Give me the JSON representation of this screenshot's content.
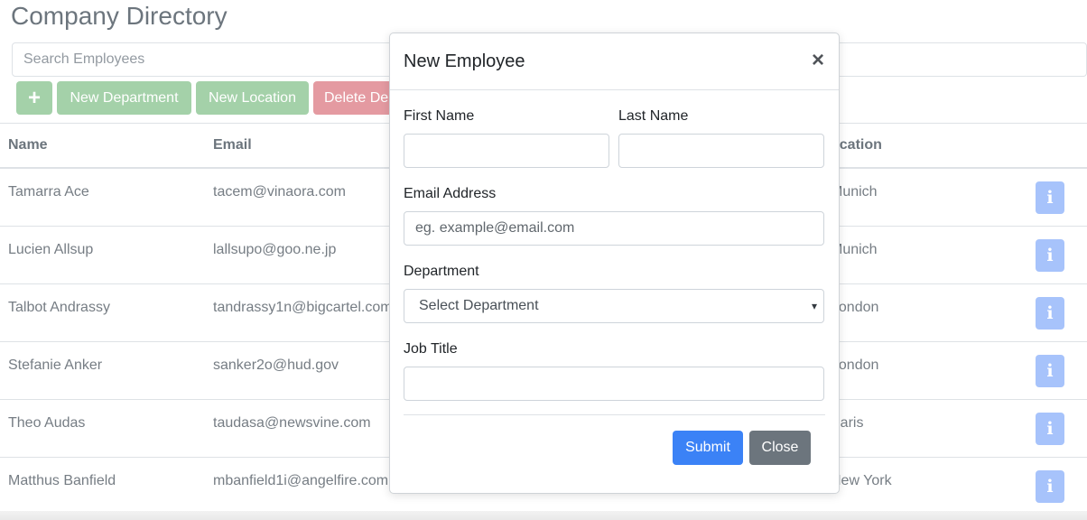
{
  "app": {
    "title": "Company Directory"
  },
  "search": {
    "placeholder": "Search Employees"
  },
  "toolbar": {
    "add_label": "+",
    "new_department_label": "New Department",
    "new_location_label": "New Location",
    "delete_label": "Delete De",
    "colors": {
      "success": "#a4d1a9",
      "danger": "#e49aa1"
    }
  },
  "table": {
    "headers": {
      "name": "Name",
      "email": "Email",
      "location": "ocation"
    },
    "rows": [
      {
        "name": "Tamarra Ace",
        "email": "tacem@vinaora.com",
        "location": "Munich",
        "info_icon": "i"
      },
      {
        "name": "Lucien Allsup",
        "email": "lallsupo@goo.ne.jp",
        "location": "Munich",
        "info_icon": "i"
      },
      {
        "name": "Talbot Andrassy",
        "email": "tandrassy1n@bigcartel.com",
        "location": "London",
        "info_icon": "i"
      },
      {
        "name": "Stefanie Anker",
        "email": "sanker2o@hud.gov",
        "location": "London",
        "info_icon": "i"
      },
      {
        "name": "Theo Audas",
        "email": "taudasa@newsvine.com",
        "location": "Paris",
        "info_icon": "i"
      },
      {
        "name": "Matthus Banfield",
        "email": "mbanfield1i@angelfire.com",
        "location": "New York",
        "info_icon": "i"
      }
    ]
  },
  "modal": {
    "title": "New Employee",
    "close_icon": "×",
    "first_name": {
      "label": "First Name",
      "value": ""
    },
    "last_name": {
      "label": "Last Name",
      "value": ""
    },
    "email": {
      "label": "Email Address",
      "placeholder": "eg. example@email.com"
    },
    "department": {
      "label": "Department",
      "selected": "Select Department"
    },
    "job_title": {
      "label": "Job Title",
      "value": ""
    },
    "submit_label": "Submit",
    "close_label": "Close",
    "colors": {
      "primary": "#3b82f6",
      "secondary": "#6c757d"
    }
  }
}
